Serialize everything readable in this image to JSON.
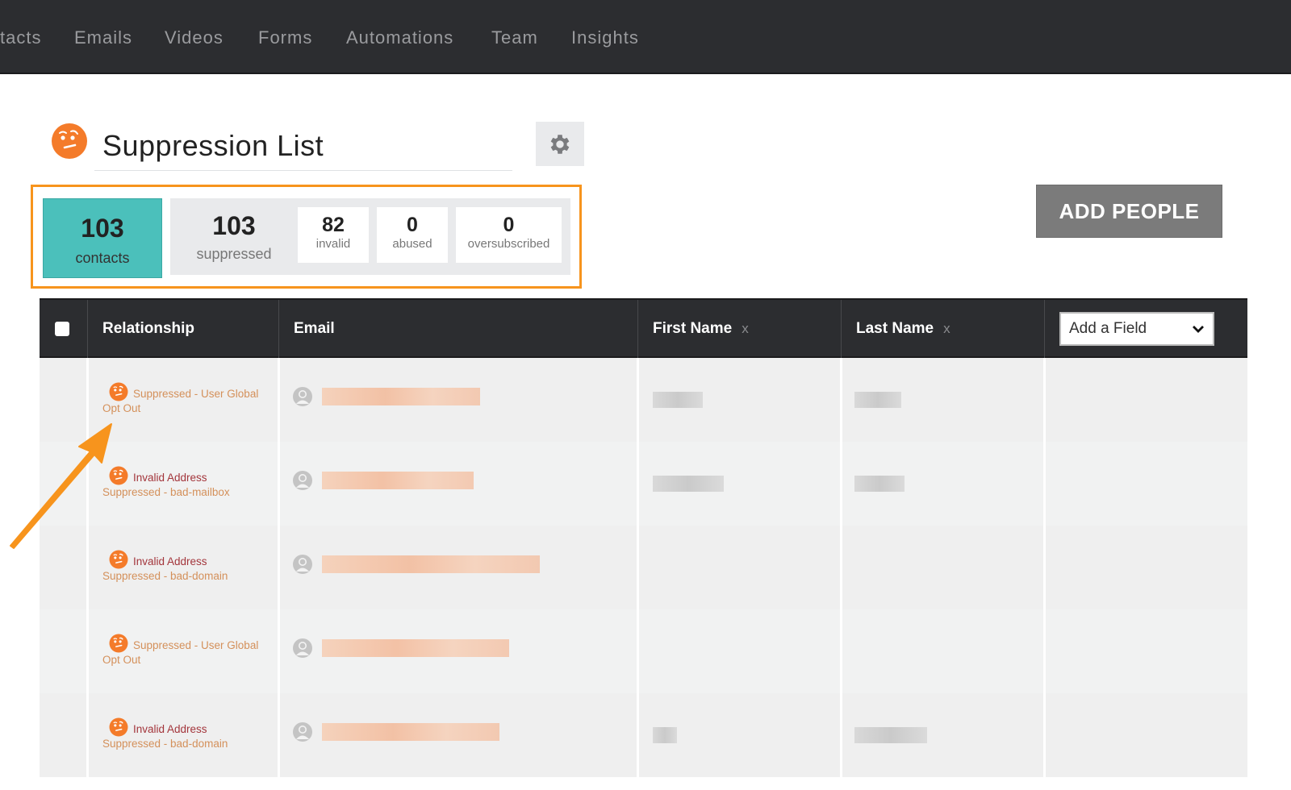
{
  "nav": {
    "items": [
      "tacts",
      "Emails",
      "Videos",
      "Forms",
      "Automations",
      "Team",
      "Insights"
    ]
  },
  "header": {
    "title": "Suppression List",
    "avatar_icon": "confused-face-icon",
    "settings_icon": "gear-icon"
  },
  "stats": {
    "contacts": {
      "value": "103",
      "label": "contacts"
    },
    "suppressed": {
      "value": "103",
      "label": "suppressed"
    },
    "invalid": {
      "value": "82",
      "label": "invalid"
    },
    "abused": {
      "value": "0",
      "label": "abused"
    },
    "oversubscribed": {
      "value": "0",
      "label": "oversubscribed"
    }
  },
  "actions": {
    "add_people": "ADD PEOPLE"
  },
  "table": {
    "columns": {
      "relationship": "Relationship",
      "email": "Email",
      "first_name": "First Name",
      "last_name": "Last Name",
      "remove": "x"
    },
    "add_field": {
      "selected": "Add a Field"
    },
    "rows": [
      {
        "status_primary": "Suppressed - User Global",
        "status_secondary": "Opt Out",
        "type": "suppressed",
        "email": "[redacted]",
        "first_name": "[redacted]",
        "last_name": "[redacted]"
      },
      {
        "status_primary": "Invalid Address",
        "status_secondary": "Suppressed - bad-mailbox",
        "type": "invalid",
        "email": "[redacted]",
        "first_name": "[redacted]",
        "last_name": "[redacted]"
      },
      {
        "status_primary": "Invalid Address",
        "status_secondary": "Suppressed - bad-domain",
        "type": "invalid",
        "email": "[redacted]",
        "first_name": "",
        "last_name": ""
      },
      {
        "status_primary": "Suppressed - User Global",
        "status_secondary": "Opt Out",
        "type": "suppressed",
        "email": "[redacted]",
        "first_name": "",
        "last_name": ""
      },
      {
        "status_primary": "Invalid Address",
        "status_secondary": "Suppressed - bad-domain",
        "type": "invalid",
        "email": "[redacted]",
        "first_name": "[redacted]",
        "last_name": "[redacted]"
      }
    ]
  },
  "colors": {
    "nav_bg": "#2c2d30",
    "accent_orange": "#f7941d",
    "contacts_teal": "#4bc0bb",
    "invalid_red": "#a3353b",
    "status_tan": "#d4905a"
  }
}
